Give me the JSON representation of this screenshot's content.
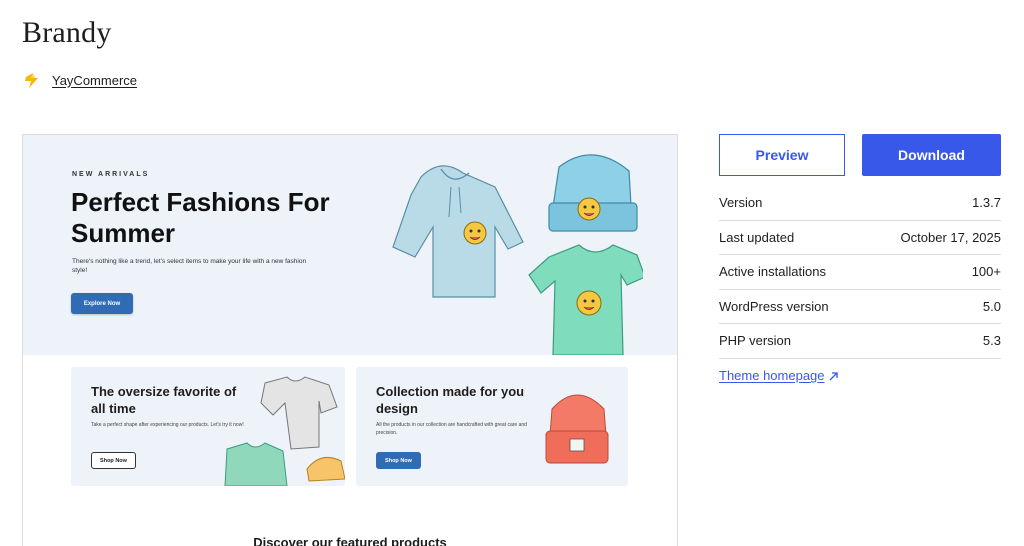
{
  "theme": {
    "title": "Brandy",
    "author": "YayCommerce"
  },
  "preview": {
    "eyebrow": "NEW ARRIVALS",
    "hero_title": "Perfect Fashions For Summer",
    "hero_desc": "There's nothing like a trend, let's select items to make your life with a new fashion style!",
    "hero_button": "Explore Now",
    "cards": [
      {
        "title": "The oversize favorite of all time",
        "desc": "Take a perfect shape after experiencing our products. Let's try it now!",
        "button": "Shop Now"
      },
      {
        "title": "Collection made for you design",
        "desc": "All the products in our collection are handcrafted with great care and precision.",
        "button": "Shop Now"
      }
    ],
    "featured_heading": "Discover our featured products"
  },
  "actions": {
    "preview_label": "Preview",
    "download_label": "Download"
  },
  "meta": [
    {
      "key": "Version",
      "value": "1.3.7"
    },
    {
      "key": "Last updated",
      "value": "October 17, 2025"
    },
    {
      "key": "Active installations",
      "value": "100+"
    },
    {
      "key": "WordPress version",
      "value": "5.0"
    },
    {
      "key": "PHP version",
      "value": "5.3"
    }
  ],
  "theme_homepage_label": "Theme homepage",
  "colors": {
    "accent": "#3858e9",
    "hero_bg": "#eef2f9",
    "hero_button": "#2f6cb3",
    "author_icon": "#f5b800"
  },
  "icons": {
    "author": "lightning-bolt-icon",
    "external": "external-arrow-icon"
  }
}
